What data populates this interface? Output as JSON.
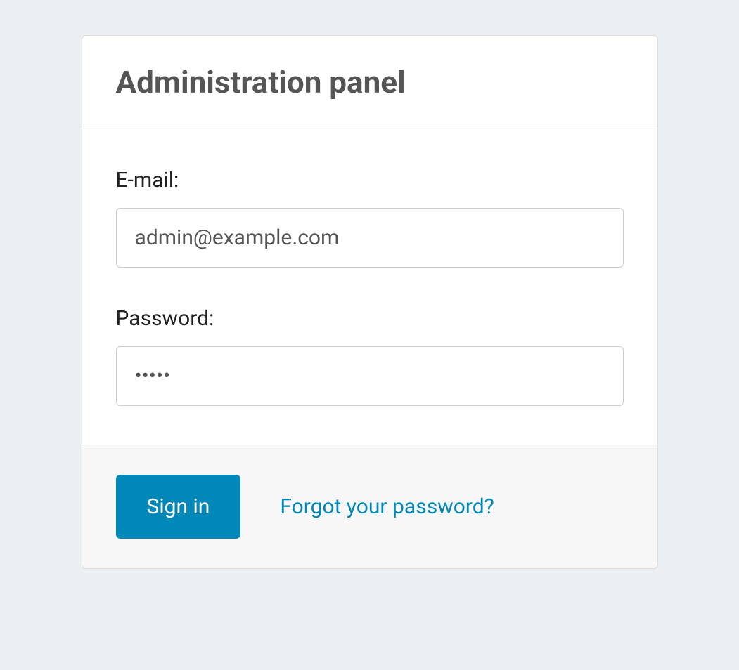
{
  "header": {
    "title": "Administration panel"
  },
  "form": {
    "email": {
      "label": "E-mail:",
      "value": "admin@example.com"
    },
    "password": {
      "label": "Password:",
      "value": "•••••"
    }
  },
  "footer": {
    "signin_label": "Sign in",
    "forgot_label": "Forgot your password?"
  }
}
